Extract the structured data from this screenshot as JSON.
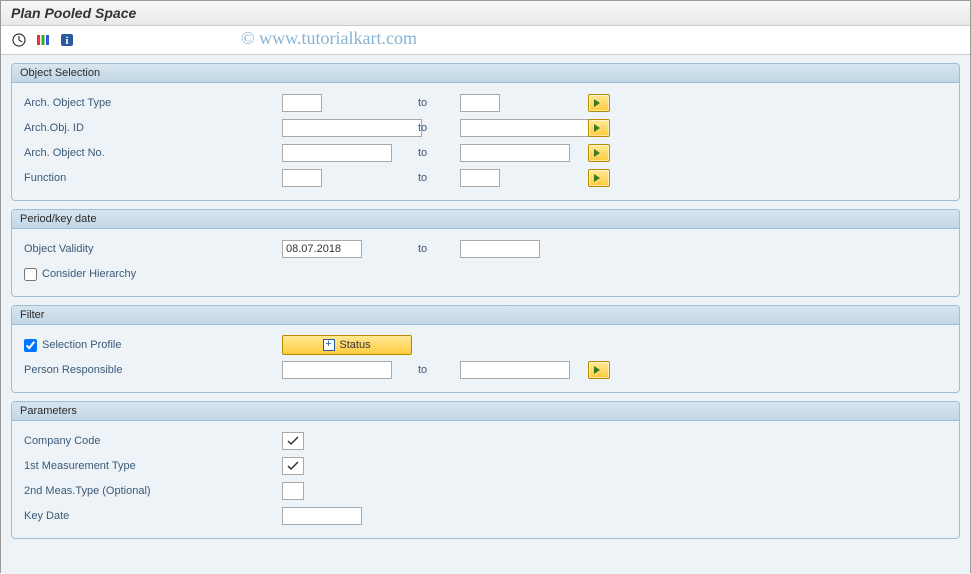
{
  "title": "Plan Pooled Space",
  "watermark": "© www.tutorialkart.com",
  "to_label": "to",
  "panels": {
    "object_selection": {
      "header": "Object Selection",
      "rows": {
        "arch_object_type": {
          "label": "Arch. Object Type",
          "from": "",
          "to": ""
        },
        "arch_obj_id": {
          "label": "Arch.Obj. ID",
          "from": "",
          "to": ""
        },
        "arch_object_no": {
          "label": "Arch. Object No.",
          "from": "",
          "to": ""
        },
        "function": {
          "label": "Function",
          "from": "",
          "to": ""
        }
      }
    },
    "period": {
      "header": "Period/key date",
      "object_validity": {
        "label": "Object Validity",
        "from": "08.07.2018",
        "to": ""
      },
      "consider_hierarchy": {
        "label": "Consider Hierarchy",
        "checked": false
      }
    },
    "filter": {
      "header": "Filter",
      "selection_profile": {
        "label": "Selection Profile",
        "checked": true
      },
      "status_button_label": "Status",
      "person_responsible": {
        "label": "Person Responsible",
        "from": "",
        "to": ""
      }
    },
    "parameters": {
      "header": "Parameters",
      "company_code": {
        "label": "Company Code",
        "checked": true
      },
      "first_meas_type": {
        "label": "1st Measurement Type",
        "checked": true
      },
      "second_meas_type": {
        "label": "2nd Meas.Type (Optional)",
        "value": ""
      },
      "key_date": {
        "label": "Key Date",
        "value": ""
      }
    }
  }
}
